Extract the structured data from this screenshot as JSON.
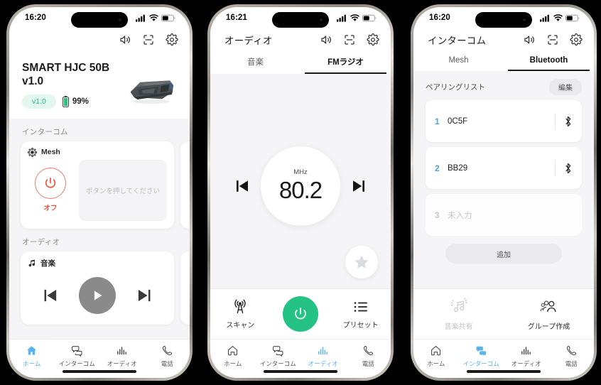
{
  "phones": {
    "home": {
      "status": {
        "time": "16:20",
        "signal_icon": "cellular-signal-icon",
        "wifi_icon": "wifi-icon",
        "battery_icon": "battery-icon"
      },
      "appbar": {
        "title": "",
        "icons": [
          "speaker-icon",
          "qr-scan-icon",
          "gear-icon"
        ]
      },
      "device": {
        "name": "SMART HJC 50B\nv1.0",
        "version_badge": "v1.0",
        "battery_percent": "99%",
        "image_alt": "headset-device-image"
      },
      "intercom": {
        "section_label": "インターコム",
        "card_label": "Mesh",
        "power_state": "オフ",
        "hint": "ボタンを押してください"
      },
      "audio": {
        "section_label": "オーディオ",
        "card_label": "音楽",
        "prev_label": "previous",
        "play_label": "play",
        "next_label": "next"
      },
      "nav": [
        {
          "label": "ホーム",
          "icon": "home-icon",
          "active": true
        },
        {
          "label": "インターコム",
          "icon": "chat-bubbles-icon",
          "active": false
        },
        {
          "label": "オーディオ",
          "icon": "equalizer-icon",
          "active": false
        },
        {
          "label": "電話",
          "icon": "phone-icon",
          "active": false
        }
      ]
    },
    "audio": {
      "status": {
        "time": "16:21"
      },
      "appbar": {
        "title": "オーディオ"
      },
      "tabs": [
        {
          "label": "音楽",
          "active": false
        },
        {
          "label": "FMラジオ",
          "active": true
        }
      ],
      "radio": {
        "unit": "MHz",
        "frequency": "80.2",
        "prev_label": "tune-down",
        "next_label": "tune-up",
        "favorite_label": "favorite"
      },
      "actions": [
        {
          "label": "スキャン",
          "icon": "antenna-icon"
        },
        {
          "label": "",
          "icon": "power-icon"
        },
        {
          "label": "プリセット",
          "icon": "list-icon"
        }
      ],
      "nav": [
        {
          "label": "ホーム",
          "icon": "home-icon",
          "active": false
        },
        {
          "label": "インターコム",
          "icon": "chat-bubbles-icon",
          "active": false
        },
        {
          "label": "オーディオ",
          "icon": "equalizer-icon",
          "active": true
        },
        {
          "label": "電話",
          "icon": "phone-icon",
          "active": false
        }
      ]
    },
    "intercom": {
      "status": {
        "time": "16:20"
      },
      "appbar": {
        "title": "インターコム"
      },
      "tabs": [
        {
          "label": "Mesh",
          "active": false
        },
        {
          "label": "Bluetooth",
          "active": true
        }
      ],
      "pairing": {
        "list_label": "ペアリングリスト",
        "edit_label": "編集",
        "rows": [
          {
            "index": "1",
            "name": "0C5F",
            "empty": false,
            "icon": "bluetooth-icon"
          },
          {
            "index": "2",
            "name": "BB29",
            "empty": false,
            "icon": "bluetooth-icon"
          },
          {
            "index": "3",
            "name": "未入力",
            "empty": true,
            "icon": ""
          }
        ],
        "add_label": "追加"
      },
      "actions": [
        {
          "label": "音楽共有",
          "icon": "music-share-icon",
          "disabled": true
        },
        {
          "label": "グループ作成",
          "icon": "group-icon",
          "disabled": false
        }
      ],
      "nav": [
        {
          "label": "ホーム",
          "icon": "home-icon",
          "active": false
        },
        {
          "label": "インターコム",
          "icon": "chat-bubbles-icon",
          "active": true
        },
        {
          "label": "オーディオ",
          "icon": "equalizer-icon",
          "active": false
        },
        {
          "label": "電話",
          "icon": "phone-icon",
          "active": false
        }
      ]
    }
  },
  "colors": {
    "accent_blue": "#58b4ef",
    "accent_green": "#25c286",
    "accent_orange": "#e8573c",
    "badge_bg": "#e2f7ed",
    "screen_bg": "#f5f5f7"
  }
}
